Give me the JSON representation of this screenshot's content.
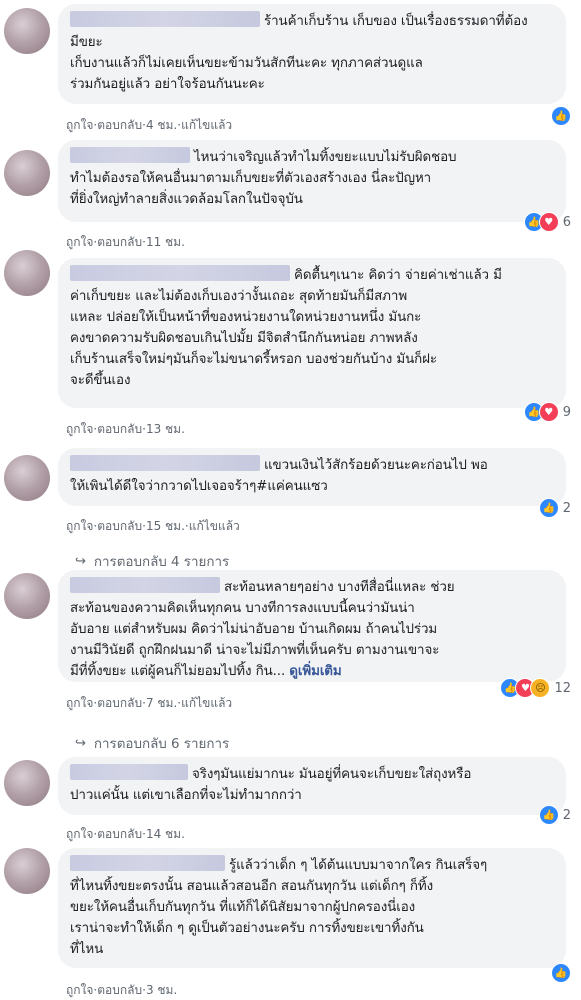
{
  "comments": [
    {
      "text": "ร้านค้าเก็บร้าน เก็บของ เป็นเรื่องธรรมดาที่ต้อง\nมีขยะ\nเก็บงานแล้วก็ไม่เคยเห็นขยะข้ามวันสักทีนะคะ ทุกภาคส่วนดูแล\nร่วมกันอยู่แล้ว อย่าใจร้อนกันนะคะ",
      "like": "ถูกใจ",
      "reply": "ตอบกลับ",
      "time": "4 ชม.",
      "edited": "แก้ไขแล้ว",
      "reaction_icons": [
        "like"
      ],
      "reaction_count": "",
      "replies_label": ""
    },
    {
      "text": "ไหนว่าเจริญแล้วทำไมทิ้งขยะแบบไม่รับผิดชอบ\nทำไมต้องรอให้คนอื่นมาตามเก็บขยะที่ตัวเองสร้างเอง นี่ละปัญหา\nที่ยิ่งใหญ่ทำลายสิ่งแวดล้อมโลกในปัจจุบัน",
      "like": "ถูกใจ",
      "reply": "ตอบกลับ",
      "time": "11 ชม.",
      "edited": "",
      "reaction_icons": [
        "like",
        "love"
      ],
      "reaction_count": "6",
      "replies_label": ""
    },
    {
      "text": "คิดตื้นๆเนาะ คิดว่า จ่ายค่าเช่าแล้ว มี\nค่าเก็บขยะ และไม่ต้องเก็บเองว่างั้นเถอะ สุดท้ายมันก็มีสภาพ\nแหละ ปล่อยให้เป็นหน้าที่ของหน่วยงานใดหน่วยงานหนึ่ง มันกะ\nคงขาดความรับผิดชอบเกินไปมั้ย มีจิตสำนึกกันหน่อย ภาพหลัง\nเก็บร้านเสร็จใหม่ๆมันก็จะไม่ขนาดรี้หรอก บองช่วยกันบ้าง มันก็ฝะ\nจะดีขึ้นเอง",
      "like": "ถูกใจ",
      "reply": "ตอบกลับ",
      "time": "13 ชม.",
      "edited": "",
      "reaction_icons": [
        "like",
        "love"
      ],
      "reaction_count": "9",
      "replies_label": ""
    },
    {
      "text": "แขวนเงินไว้สักร้อยด้วยนะคะก่อนไป พอ\nให้เพินได้ดีใจว่ากวาดไปเจอจร้าๆ#แค่คนแซว",
      "like": "ถูกใจ",
      "reply": "ตอบกลับ",
      "time": "15 ชม.",
      "edited": "แก้ไขแล้ว",
      "reaction_icons": [
        "like"
      ],
      "reaction_count": "2",
      "replies_label": "การตอบกลับ 4 รายการ"
    },
    {
      "text": "สะท้อนหลายๆอย่าง บางทีสื่อนี่แหละ ช่วย\nสะท้อนของความคิดเห็นทุกคน บางทีการลงแบบนี้คนว่ามันน่า\nอับอาย แต่สำหรับผม คิดว่าไม่น่าอับอาย บ้านเกิดผม ถ้าคนไปร่วม\nงานมีวินัยดี ถูกฝึกฝนมาดี น่าจะไม่มีภาพที่เห็นครับ ตามงานเขาจะ\nมีที่ทิ้งขยะ แต่ผู้คนก็ไม่ยอมไปทิ้ง กิน...",
      "see_more": "ดูเพิ่มเติม",
      "like": "ถูกใจ",
      "reply": "ตอบกลับ",
      "time": "7 ชม.",
      "edited": "แก้ไขแล้ว",
      "reaction_icons": [
        "like",
        "love",
        "sad"
      ],
      "reaction_count": "12",
      "replies_label": "การตอบกลับ 6 รายการ"
    },
    {
      "text": "จริงๆมันแย่มากนะ มันอยู่ที่คนจะเก็บขยะใส่ถุงหรือ\nปาวแค่นั้น แต่เขาเลือกที่จะไม่ทำมากกว่า",
      "like": "ถูกใจ",
      "reply": "ตอบกลับ",
      "time": "14 ชม.",
      "edited": "",
      "reaction_icons": [
        "like"
      ],
      "reaction_count": "2",
      "replies_label": ""
    },
    {
      "text": "รู้แล้วว่าเด็ก ๆ ได้ต้นแบบมาจากใคร กินเสร็จๆ\nที่ไหนทิ้งขยะตรงนั้น สอนแล้วสอนอีก สอนกันทุกวัน แต่เด็กๆ ก็ทิ้ง\nขยะให้คนอื่นเก็บกันทุกวัน ที่แท้ก็ได้นิสัยมาจากผู้ปกครองนี่เอง\nเราน่าจะทำให้เด็ก ๆ ดูเป็นตัวอย่างนะครับ การทิ้งขยะเขาทิ้งกัน\nที่ไหน",
      "like": "ถูกใจ",
      "reply": "ตอบกลับ",
      "time": "3 ชม.",
      "edited": "",
      "reaction_icons": [
        "like"
      ],
      "reaction_count": "",
      "replies_label": ""
    }
  ]
}
